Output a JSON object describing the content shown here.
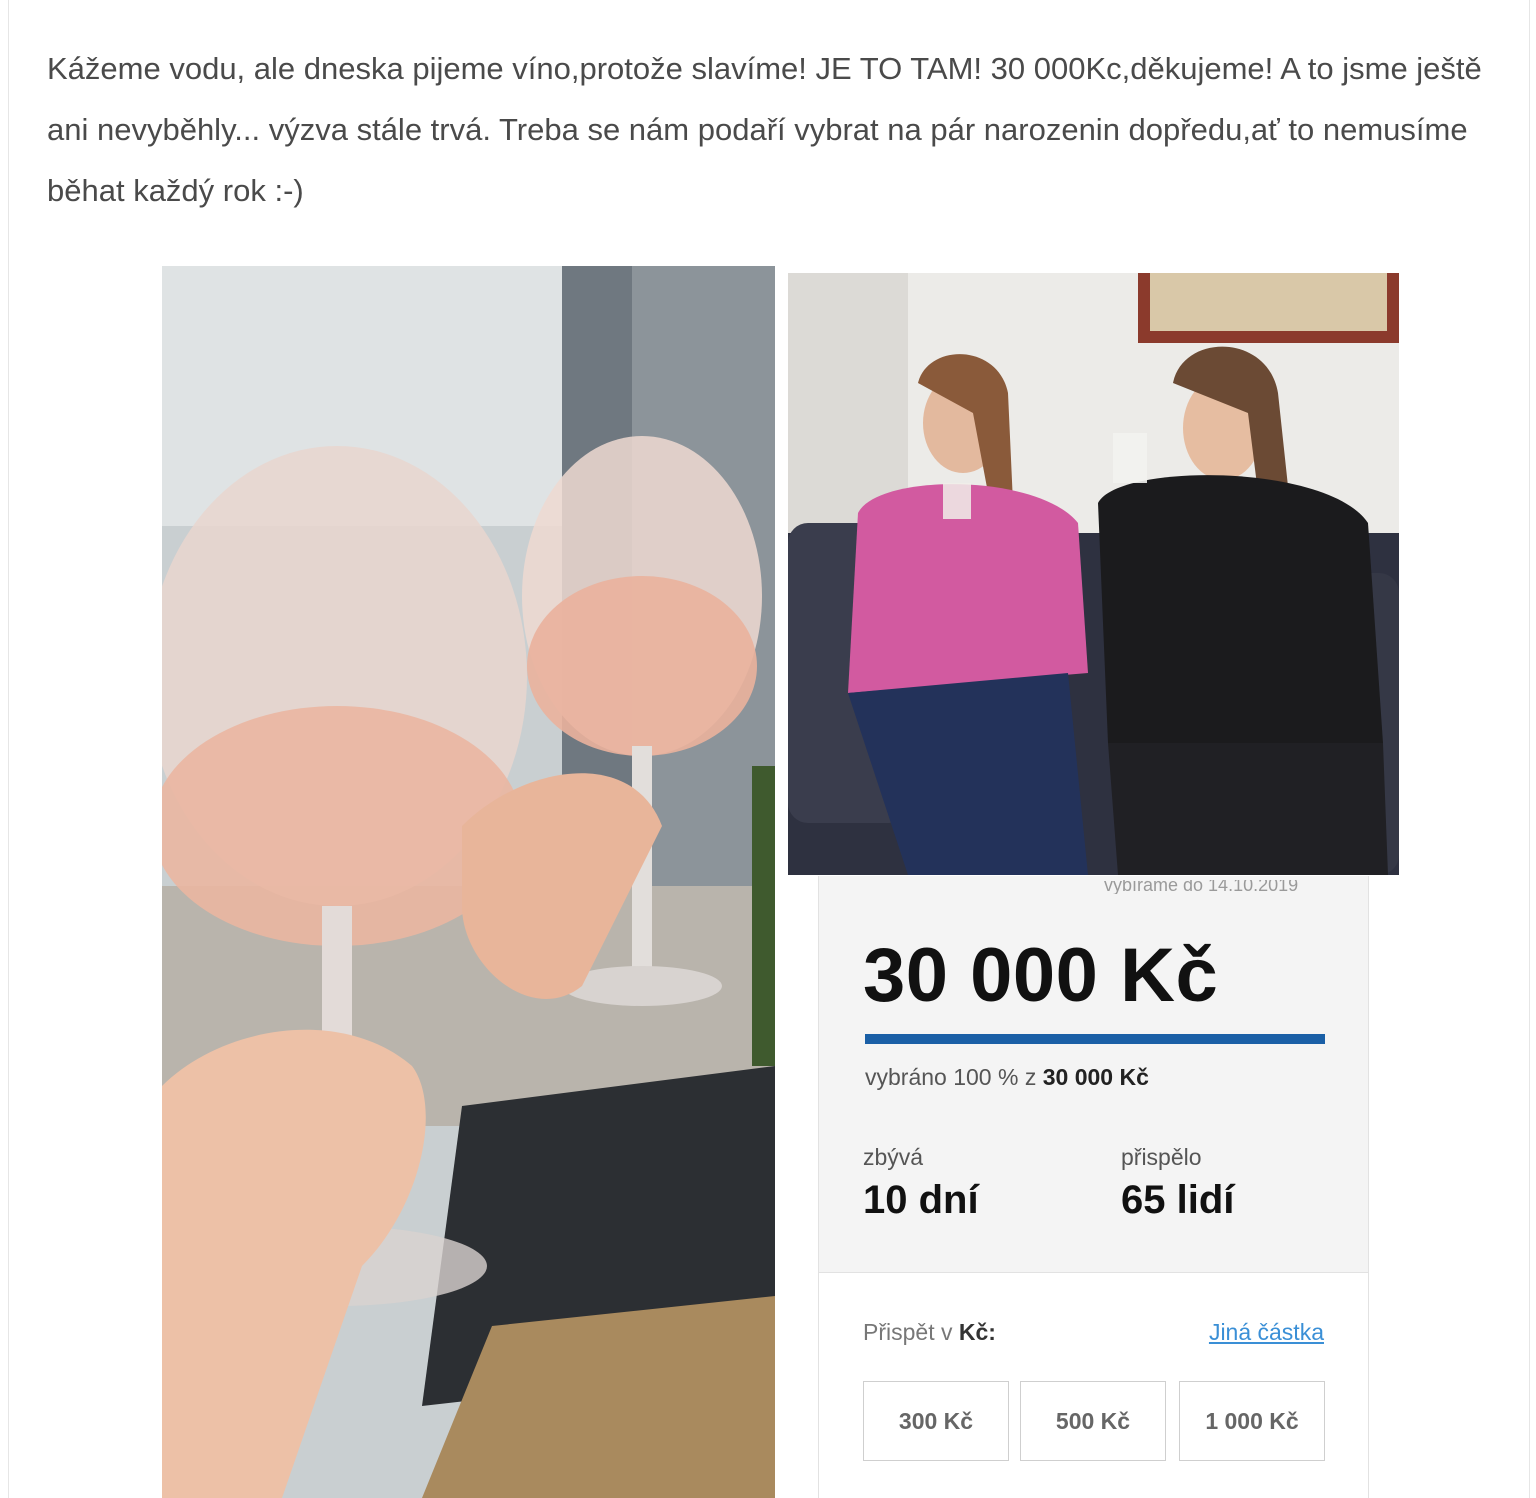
{
  "post": {
    "text": "Kážeme vodu, ale dneska pijeme víno,protože slavíme! JE TO TAM! 30 000Kc,děkujeme! A to jsme ještě ani nevyběhly... výzva stále trvá. Treba se nám podaří vybrat na pár narozenin dopředu,ať to nemusíme běhat každý rok :-)"
  },
  "photos": {
    "left": "photo-wine-glasses",
    "right": "photo-two-women-toasting"
  },
  "campaign": {
    "cutoff_text": "vybíráme do 14.10.2019",
    "amount": "30 000 Kč",
    "progress_percent": 100,
    "raised_prefix": "vybráno 100 % z ",
    "raised_goal": "30 000 Kč",
    "remaining_label": "zbývá",
    "remaining_value": "10 dní",
    "contributors_label": "přispělo",
    "contributors_value": "65 lidí",
    "donate_prefix": "Přispět v ",
    "donate_currency": "Kč:",
    "other_amount": "Jiná částka",
    "amount_options": [
      "300 Kč",
      "500 Kč",
      "1 000 Kč"
    ],
    "accent_color": "#1a5fa6",
    "link_color": "#3a8fd6"
  }
}
